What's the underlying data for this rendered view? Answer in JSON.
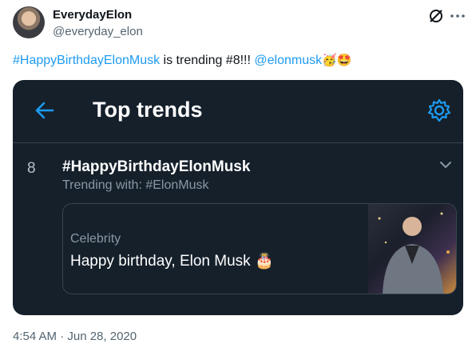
{
  "author": {
    "display_name": "EverydayElon",
    "handle": "@everyday_elon"
  },
  "tweet": {
    "link_hashtag": "#HappyBirthdayElonMusk",
    "middle_text": " is trending #8!!! ",
    "mention": "@elonmusk",
    "emojis": "🥳🤩"
  },
  "card": {
    "header_title": "Top trends",
    "rank": "8",
    "hashtag": "#HappyBirthdayElonMusk",
    "trending_with": "Trending with: #ElonMusk",
    "category": "Celebrity",
    "headline": "Happy birthday, Elon Musk",
    "headline_emoji": "🎂"
  },
  "timestamp": "4:54 AM · Jun 28, 2020",
  "colors": {
    "accent": "#1d9bf0",
    "card_bg": "#15202b"
  }
}
